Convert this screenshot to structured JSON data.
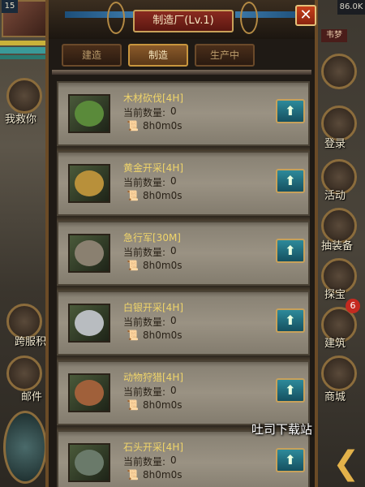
{
  "window": {
    "title": "制造厂(Lv.1)",
    "close_label": "✕"
  },
  "tabs": [
    {
      "label": "建造",
      "active": false
    },
    {
      "label": "制造",
      "active": true
    },
    {
      "label": "生产中",
      "active": false
    }
  ],
  "items": [
    {
      "name": "木材砍伐[4H]",
      "count_label": "当前数量:",
      "count": "0",
      "time": "8h0m0s",
      "icon": "lumber-icon"
    },
    {
      "name": "黄金开采[4H]",
      "count_label": "当前数量:",
      "count": "0",
      "time": "8h0m0s",
      "icon": "gold-icon"
    },
    {
      "name": "急行军[30M]",
      "count_label": "当前数量:",
      "count": "0",
      "time": "8h0m0s",
      "icon": "march-icon"
    },
    {
      "name": "白银开采[4H]",
      "count_label": "当前数量:",
      "count": "0",
      "time": "8h0m0s",
      "icon": "silver-icon"
    },
    {
      "name": "动物狩猎[4H]",
      "count_label": "当前数量:",
      "count": "0",
      "time": "8h0m0s",
      "icon": "hunt-icon"
    },
    {
      "name": "石头开采[4H]",
      "count_label": "当前数量:",
      "count": "0",
      "time": "8h0m0s",
      "icon": "stone-icon"
    }
  ],
  "upgrade_glyph": "⬆",
  "scroll_glyph": "📜",
  "background": {
    "level": "15",
    "resource_top": "86.0K",
    "resource_chip": "韦梦",
    "left_labels": [
      "我救你",
      "跨服积",
      "邮件"
    ],
    "right_labels": [
      "登录",
      "活动",
      "抽装备",
      "探宝",
      "建筑",
      "商城"
    ],
    "badge": "6",
    "back_glyph": "❮"
  },
  "watermark": "吐司下载站",
  "colors": {
    "item_title": "#f0d56a",
    "title_plate": "#8a2a20",
    "upgrade_button": "#2d8a9a",
    "close_button": "#c8401a"
  }
}
